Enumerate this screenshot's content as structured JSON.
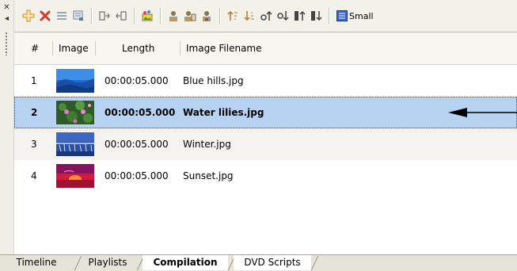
{
  "toolbar": {
    "buttons": [
      {
        "icon": "add-icon",
        "color": "#e8a22a"
      },
      {
        "icon": "delete-icon",
        "color": "#d23a2a"
      },
      {
        "icon": "align-icon",
        "color": "#9aa6b6"
      },
      {
        "icon": "properties-icon",
        "color": "#6b7b92"
      },
      {
        "icon": "import-icon",
        "color": "#555555"
      },
      {
        "icon": "export-icon",
        "color": "#555555"
      },
      {
        "icon": "image-effects-icon",
        "color": "#c04a8a"
      },
      {
        "icon": "user-icon",
        "color": "#7b6a4a"
      },
      {
        "icon": "user-edit-icon",
        "color": "#7b6a4a"
      },
      {
        "icon": "user-star-icon",
        "color": "#7b6a4a"
      },
      {
        "icon": "sort-up-icon",
        "color": "#b7772b"
      },
      {
        "icon": "sort-down-icon",
        "color": "#b7772b"
      },
      {
        "icon": "move-up-icon",
        "color": "#444444"
      },
      {
        "icon": "move-down-icon",
        "color": "#444444"
      },
      {
        "icon": "move-top-icon",
        "color": "#444444"
      },
      {
        "icon": "move-bottom-icon",
        "color": "#444444"
      }
    ],
    "view_size_label": "Small"
  },
  "table": {
    "columns": [
      "#",
      "Image",
      "Length",
      "Image Filename"
    ],
    "rows": [
      {
        "num": "1",
        "length": "00:00:05.000",
        "filename": "Blue hills.jpg",
        "thumb": "blue-hills"
      },
      {
        "num": "2",
        "length": "00:00:05.000",
        "filename": "Water lilies.jpg",
        "thumb": "water-lilies",
        "selected": true
      },
      {
        "num": "3",
        "length": "00:00:05.000",
        "filename": "Winter.jpg",
        "thumb": "winter"
      },
      {
        "num": "4",
        "length": "00:00:05.000",
        "filename": "Sunset.jpg",
        "thumb": "sunset"
      }
    ]
  },
  "tabs": [
    "Timeline",
    "Playlists",
    "Compilation",
    "DVD Scripts"
  ],
  "active_tab": "Compilation",
  "colors": {
    "selection": "#b8d3f2",
    "tab_bar": "#e6e4d8"
  }
}
